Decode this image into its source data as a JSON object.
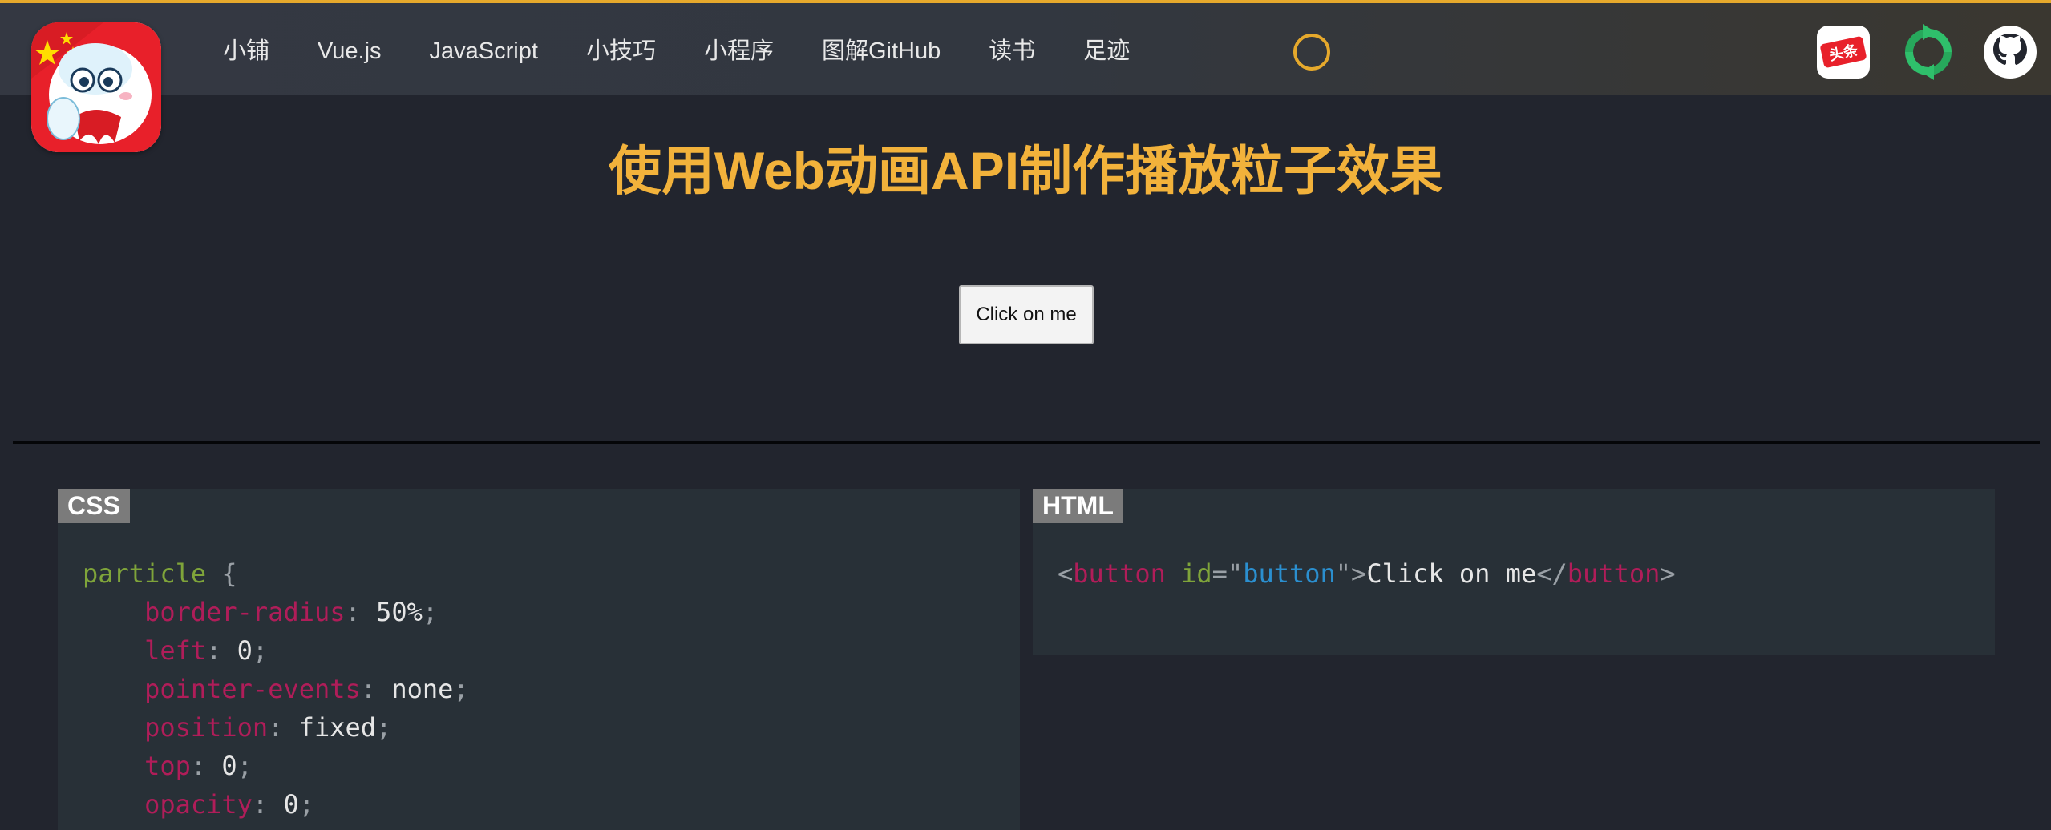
{
  "nav": {
    "items": [
      "小铺",
      "Vue.js",
      "JavaScript",
      "小技巧",
      "小程序",
      "图解GitHub",
      "读书",
      "足迹"
    ]
  },
  "social": {
    "toutiao_label": "头条",
    "icons": [
      "toutiao-icon",
      "refresh-logo-icon",
      "github-icon"
    ]
  },
  "colors": {
    "accent": "#f2b23b",
    "background": "#22252e",
    "panel": "#283037"
  },
  "page": {
    "title": "使用Web动画API制作播放粒子效果"
  },
  "demo": {
    "button_label": "Click on me"
  },
  "css_panel": {
    "tag": "CSS",
    "selector": "particle",
    "open_brace": " {",
    "rules": [
      {
        "prop": "border-radius",
        "value": "50%"
      },
      {
        "prop": "left",
        "value": "0"
      },
      {
        "prop": "pointer-events",
        "value": "none"
      },
      {
        "prop": "position",
        "value": "fixed"
      },
      {
        "prop": "top",
        "value": "0"
      },
      {
        "prop": "opacity",
        "value": "0"
      }
    ]
  },
  "html_panel": {
    "tag": "HTML",
    "element": "button",
    "attr": "id",
    "attr_value": "button",
    "text": "Click on me"
  }
}
